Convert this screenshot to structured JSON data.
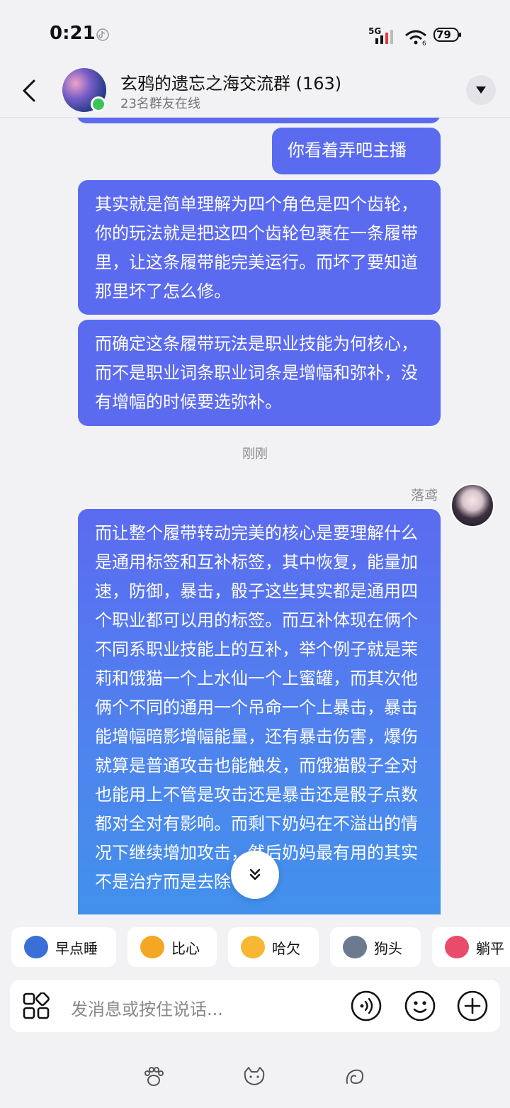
{
  "status_bar": {
    "time": "0:21",
    "network": "5G",
    "battery": "79"
  },
  "header": {
    "title": "玄鸦的遗忘之海交流群 (163)",
    "subtitle": "23名群友在线"
  },
  "messages": [
    {
      "text": "你看着弄吧主播"
    },
    {
      "text": "其实就是简单理解为四个角色是四个齿轮，你的玩法就是把这四个齿轮包裹在一条履带里，让这条履带能完美运行。而坏了要知道那里坏了怎么修。"
    },
    {
      "text": "而确定这条履带玩法是职业技能为何核心，而不是职业词条职业词条是增幅和弥补，没有增幅的时候要选弥补。"
    },
    {
      "text": "而让整个履带转动完美的核心是要理解什么是通用标签和互补标签，其中恢复，能量加速，防御，暴击，骰子这些其实都是通用四个职业都可以用的标签。而互补体现在俩个不同系职业技能上的互补，举个例子就是茉莉和饿猫一个上水仙一个上蜜罐，而其次他俩个不同的通用一个吊命一个上暴击，暴击能增幅暗影增幅能量，还有暴击伤害，爆伤就算是普通攻击也能触发，而饿猫骰子全对也能用上不管是攻击还是暴击还是骰子点数都对全对有影响。而剩下奶妈在不溢出的情况下继续增加攻击，然后奶妈最有用的其实不是治疗而是去除"
    }
  ],
  "time_separator": "刚刚",
  "sender": {
    "name": "落鸢"
  },
  "quick_stickers": [
    {
      "label": "早点睡",
      "color": "#3b6fd8"
    },
    {
      "label": "比心",
      "color": "#f5a623"
    },
    {
      "label": "哈欠",
      "color": "#f7b733"
    },
    {
      "label": "狗头",
      "color": "#6b7a8f"
    },
    {
      "label": "躺平",
      "color": "#e94b6a"
    }
  ],
  "input": {
    "placeholder": "发消息或按住说话..."
  }
}
